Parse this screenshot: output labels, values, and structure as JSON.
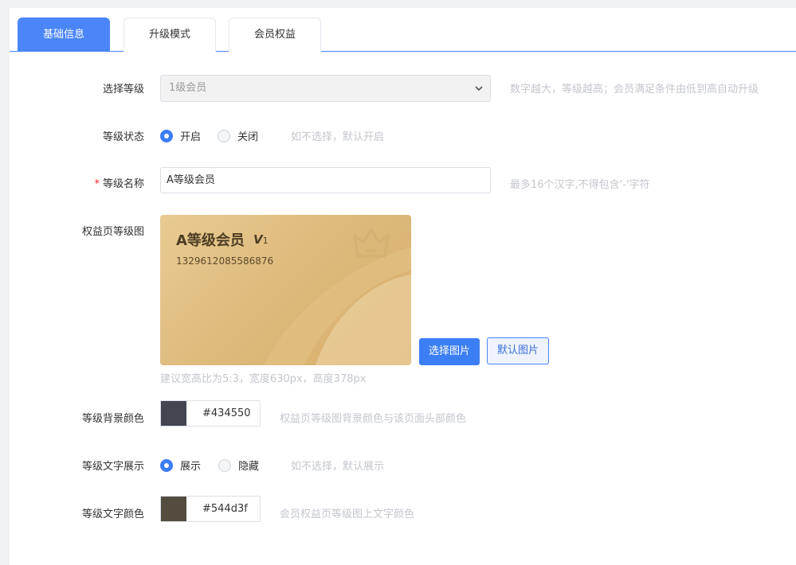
{
  "tabs": [
    {
      "label": "基础信息",
      "active": true
    },
    {
      "label": "升级模式",
      "active": false
    },
    {
      "label": "会员权益",
      "active": false
    }
  ],
  "form": {
    "level_select": {
      "label": "选择等级",
      "value": "1级会员",
      "hint": "数字越大，等级越高；会员满足条件由低到高自动升级"
    },
    "level_status": {
      "label": "等级状态",
      "options": [
        "开启",
        "关闭"
      ],
      "selected": "开启",
      "hint": "如不选择，默认开启"
    },
    "level_name": {
      "required_mark": "*",
      "label": "等级名称",
      "value": "A等级会员",
      "hint": "最多16个汉字,不得包含'-'字符"
    },
    "level_image": {
      "label": "权益页等级图",
      "card_title": "A等级会员",
      "card_badge": "V",
      "card_badge_num": "1",
      "card_number": "1329612085586876",
      "select_button": "选择图片",
      "default_button": "默认图片",
      "hint": "建议宽高比为5:3，宽度630px，高度378px"
    },
    "bg_color": {
      "label": "等级背景颜色",
      "value": "#434550",
      "hint": "权益页等级图背景颜色与该页面头部颜色"
    },
    "text_display": {
      "label": "等级文字展示",
      "options": [
        "展示",
        "隐藏"
      ],
      "selected": "展示",
      "hint": "如不选择，默认展示"
    },
    "text_color": {
      "label": "等级文字颜色",
      "value": "#544d3f",
      "hint": "会员权益页等级图上文字颜色"
    }
  },
  "colors": {
    "accent": "#3c7ef6",
    "swatch_bg": "#434550",
    "swatch_text": "#544d3f"
  }
}
